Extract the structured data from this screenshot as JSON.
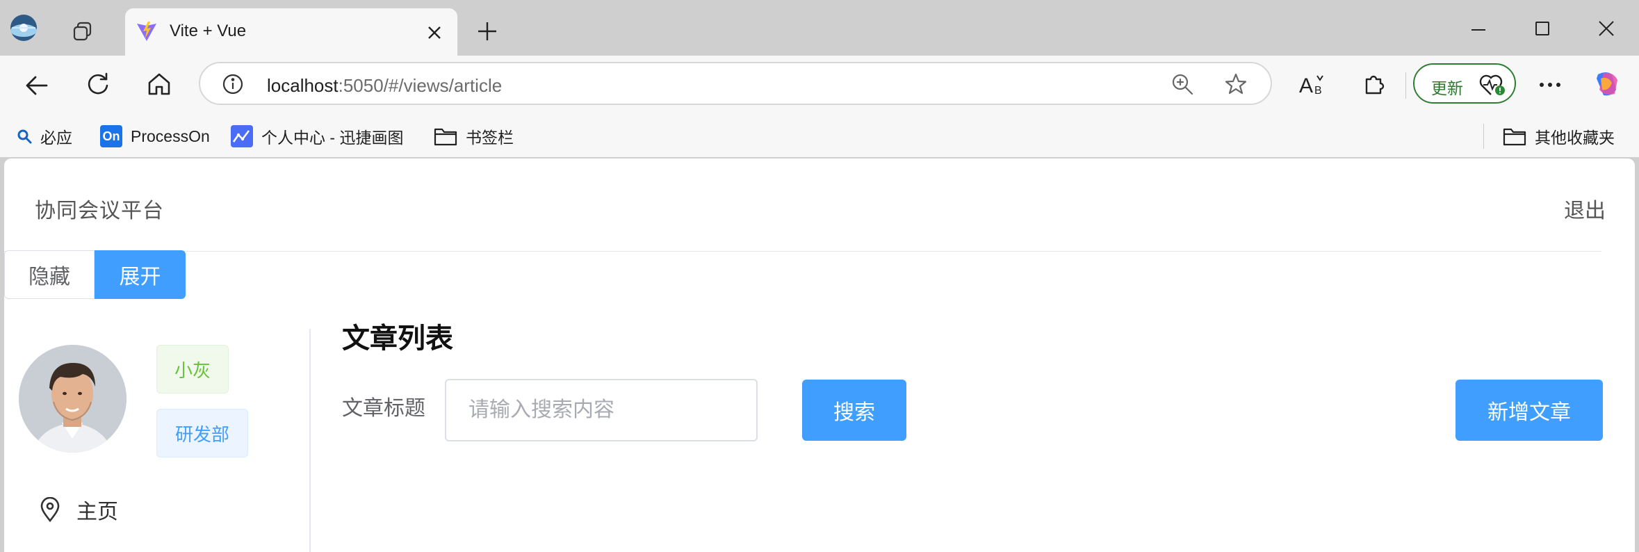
{
  "browser": {
    "tab_title": "Vite + Vue",
    "url_host": "localhost",
    "url_rest": ":5050/#/views/article",
    "update_label": "更新"
  },
  "bookmarks": {
    "items": [
      {
        "label": "必应",
        "icon": "search-icon"
      },
      {
        "label": "ProcessOn",
        "icon": "processon-icon",
        "badge": "On"
      },
      {
        "label": "个人中心 - 迅捷画图",
        "icon": "chart-icon"
      },
      {
        "label": "书签栏",
        "icon": "folder-icon"
      }
    ],
    "other": "其他收藏夹"
  },
  "app": {
    "brand": "协同会议平台",
    "logout": "退出",
    "toggle": {
      "hide": "隐藏",
      "show": "展开"
    },
    "user": {
      "name": "小灰",
      "department": "研发部"
    },
    "menu": [
      {
        "label": "主页",
        "icon": "location-icon"
      }
    ]
  },
  "main": {
    "title": "文章列表",
    "search": {
      "label": "文章标题",
      "placeholder": "请输入搜索内容",
      "value": "",
      "button": "搜索"
    },
    "add_button": "新增文章"
  },
  "colors": {
    "primary": "#409eff",
    "success": "#67c23a",
    "update_green": "#2f7d32"
  }
}
